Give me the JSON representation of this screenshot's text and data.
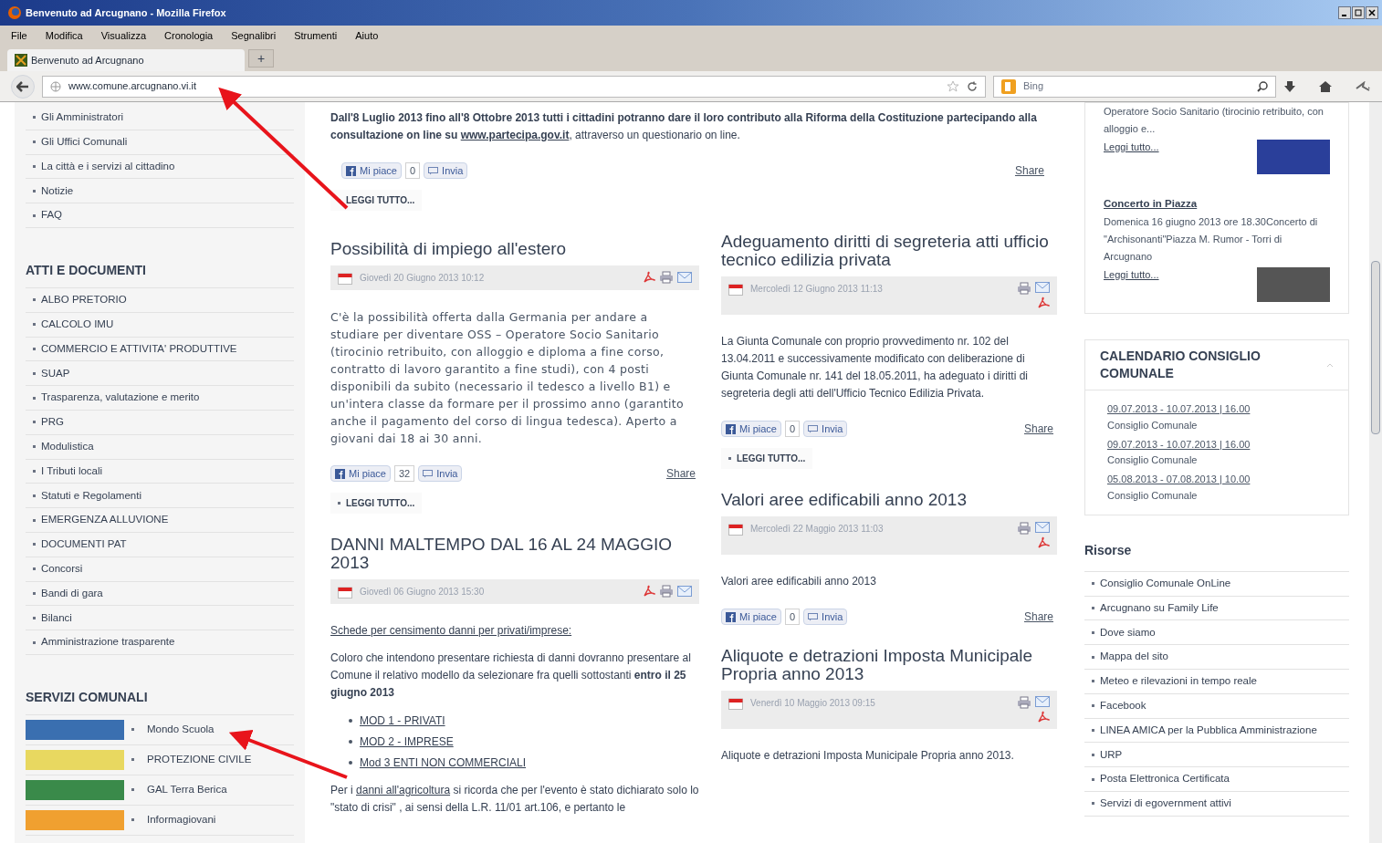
{
  "window": {
    "title": "Benvenuto ad Arcugnano - Mozilla Firefox"
  },
  "menu": [
    "File",
    "Modifica",
    "Visualizza",
    "Cronologia",
    "Segnalibri",
    "Strumenti",
    "Aiuto"
  ],
  "tabs": [
    {
      "label": "Benvenuto ad Arcugnano",
      "selected": true
    }
  ],
  "new_tab": "+",
  "address": {
    "value": "www.comune.arcugnano.vi.it"
  },
  "search": {
    "placeholder": "Bing"
  },
  "sidebar": [
    {
      "items": [
        "Gli Amministratori",
        "Gli Uffici Comunali",
        "La città e i servizi al cittadino",
        "Notizie",
        "FAQ"
      ]
    },
    {
      "title": "ATTI E DOCUMENTI",
      "items": [
        "ALBO PRETORIO",
        "CALCOLO IMU",
        "COMMERCIO E ATTIVITA' PRODUTTIVE",
        "SUAP",
        "Trasparenza, valutazione e merito",
        "PRG",
        "Modulistica",
        "I Tributi locali",
        "Statuti e Regolamenti",
        "EMERGENZA ALLUVIONE",
        "DOCUMENTI PAT",
        "Concorsi",
        "Bandi di gara",
        "Bilanci",
        "Amministrazione trasparente"
      ]
    },
    {
      "title": "SERVIZI COMUNALI",
      "logos": [
        "Mondo Scuola",
        "PROTEZIONE CIVILE",
        "GAL Terra Berica",
        "Informagiovani"
      ]
    }
  ],
  "intro": {
    "bold": "Dall'8 Luglio 2013 fino all'8 Ottobre 2013 tutti i cittadini potranno dare il loro contributo alla Riforma della Costituzione partecipando alla consultazione on line su",
    "link": "www.partecipa.gov.it",
    "rest": ", attraverso un questionario on line.",
    "like": "Mi piace",
    "count": "0",
    "send": "Invia",
    "share": "Share",
    "more": "LEGGI TUTTO..."
  },
  "columns": [
    [
      {
        "title": "Possibilità di impiego all'estero",
        "date": "Giovedì 20 Giugno 2013 10:12",
        "kind": "row",
        "body": [
          {
            "kind": "serif",
            "text": "C'è la possibilità offerta dalla Germania per andare a studiare per diventare OSS – Operatore Socio Sanitario (tirocinio retribuito, con alloggio e diploma a fine corso, contratto di lavoro garantito a fine studi), con 4 posti disponibili da subito (necessario il tedesco a livello B1) e un'intera classe da formare per il prossimo anno (garantito anche il pagamento del corso di lingua tedesca). Aperto a giovani dai 18 ai 30 anni."
          }
        ],
        "social": {
          "like": "Mi piace",
          "count": "32",
          "send": "Invia",
          "share": "Share"
        },
        "more": "LEGGI TUTTO..."
      },
      {
        "title": "DANNI MALTEMPO DAL 16 AL 24 MAGGIO 2013",
        "date": "Giovedì 06 Giugno 2013 15:30",
        "kind": "row",
        "body": [
          {
            "kind": "link",
            "text": "Schede per censimento danni per privati/imprese:"
          },
          {
            "kind": "text",
            "text": "Coloro che intendono presentare richiesta di danni dovranno presentare al Comune il relativo modello da selezionare fra quelli sottostanti **entro il 25 giugno 2013**"
          },
          {
            "kind": "links",
            "items": [
              "MOD 1 - PRIVATI",
              "MOD 2 - IMPRESE",
              "Mod 3 ENTI NON COMMERCIALI"
            ]
          },
          {
            "kind": "link_text",
            "before": "Per i",
            "link": "danni all'agricoltura",
            "after": "si ricorda che per l'evento è stato dichiarato solo lo \"stato di crisi\" , ai sensi della L.R. 11/01 art.106, e pertanto le"
          }
        ]
      }
    ],
    [
      {
        "title": "Adeguamento diritti di segreteria atti ufficio tecnico edilizia privata",
        "date": "Mercoledì 12 Giugno 2013 11:13",
        "kind": "stacked",
        "body": [
          {
            "kind": "text",
            "text": "La Giunta Comunale con proprio provvedimento nr. 102 del 13.04.2011 e successivamente modificato con deliberazione di Giunta Comunale nr. 141 del 18.05.2011, ha adeguato i diritti di segreteria degli atti dell'Ufficio Tecnico Edilizia Privata."
          }
        ],
        "social": {
          "like": "Mi piace",
          "count": "0",
          "send": "Invia",
          "share": "Share"
        },
        "more": "LEGGI TUTTO..."
      },
      {
        "title": "Valori aree edificabili anno 2013",
        "date": "Mercoledì 22 Maggio 2013 11:03",
        "kind": "stacked",
        "body": [
          {
            "kind": "text",
            "text": "Valori aree edificabili anno 2013"
          }
        ],
        "social": {
          "like": "Mi piace",
          "count": "0",
          "send": "Invia",
          "share": "Share"
        }
      },
      {
        "title": "Aliquote e detrazioni Imposta Municipale Propria anno 2013",
        "date": "Venerdì 10 Maggio 2013 09:15",
        "kind": "stacked",
        "body": [
          {
            "kind": "text",
            "text": "Aliquote e detrazioni Imposta Municipale Propria anno 2013."
          }
        ]
      }
    ]
  ],
  "news_box": [
    {
      "text": "Operatore Socio Sanitario (tirocinio retribuito, con alloggio e...",
      "more": "Leggi tutto..."
    },
    {
      "title": "Concerto in Piazza",
      "text": "Domenica 16 giugno 2013 ore 18.30Concerto di \"Archisonanti\"Piazza M. Rumor - Torri di Arcugnano",
      "more": "Leggi tutto..."
    }
  ],
  "calendar": {
    "title": "CALENDARIO CONSIGLIO COMUNALE",
    "items": [
      {
        "date": "09.07.2013 - 10.07.2013 | 16.00",
        "name": "Consiglio Comunale"
      },
      {
        "date": "09.07.2013 - 10.07.2013 | 16.00",
        "name": "Consiglio Comunale"
      },
      {
        "date": "05.08.2013 - 07.08.2013 | 10.00",
        "name": "Consiglio Comunale"
      }
    ]
  },
  "resources": {
    "title": "Risorse",
    "items": [
      "Consiglio Comunale OnLine",
      "Arcugnano su Family Life",
      "Dove siamo",
      "Mappa del sito",
      "Meteo e rilevazioni in tempo reale",
      "Facebook",
      "LINEA AMICA per la Pubblica Amministrazione",
      "URP",
      "Posta Elettronica Certificata",
      "Servizi di egovernment attivi"
    ]
  }
}
